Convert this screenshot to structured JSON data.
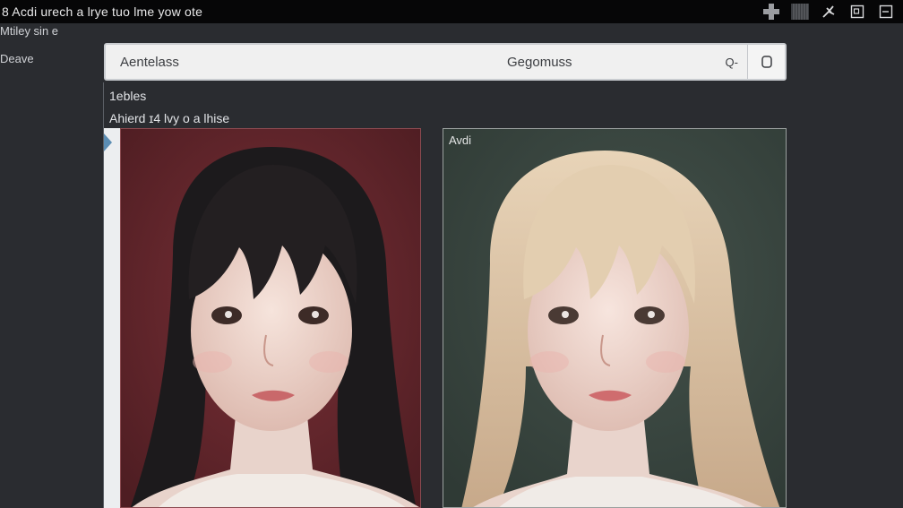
{
  "window": {
    "title": "8  Acdi urech a  lrye tuo  lme yow ote"
  },
  "toolbar": {
    "icons": [
      "plus-icon",
      "grid-icon",
      "pin-icon",
      "panel-icon",
      "window-icon"
    ]
  },
  "sidebar": {
    "label1": "Mtiley sin e",
    "label2": "Deave"
  },
  "search": {
    "left_value": "Aentelass",
    "center_value": "Gegomuss",
    "search_glyph": "Q-",
    "button_glyph": "▢"
  },
  "content": {
    "heading": "1ebles",
    "subheading": "Ahierd ɪ4 lvy o a lhise"
  },
  "panels": [
    {
      "caption": "",
      "background": "#6d2a30",
      "hair": "#1c1a1c"
    },
    {
      "caption": "Avdi",
      "background": "#3d4a44",
      "hair": "#d9c2a3"
    }
  ],
  "colors": {
    "page_bg": "#2a2c30",
    "titlebar_bg": "#060607",
    "search_bg": "#f0f0f0",
    "accent_marker": "#5b8db3"
  }
}
